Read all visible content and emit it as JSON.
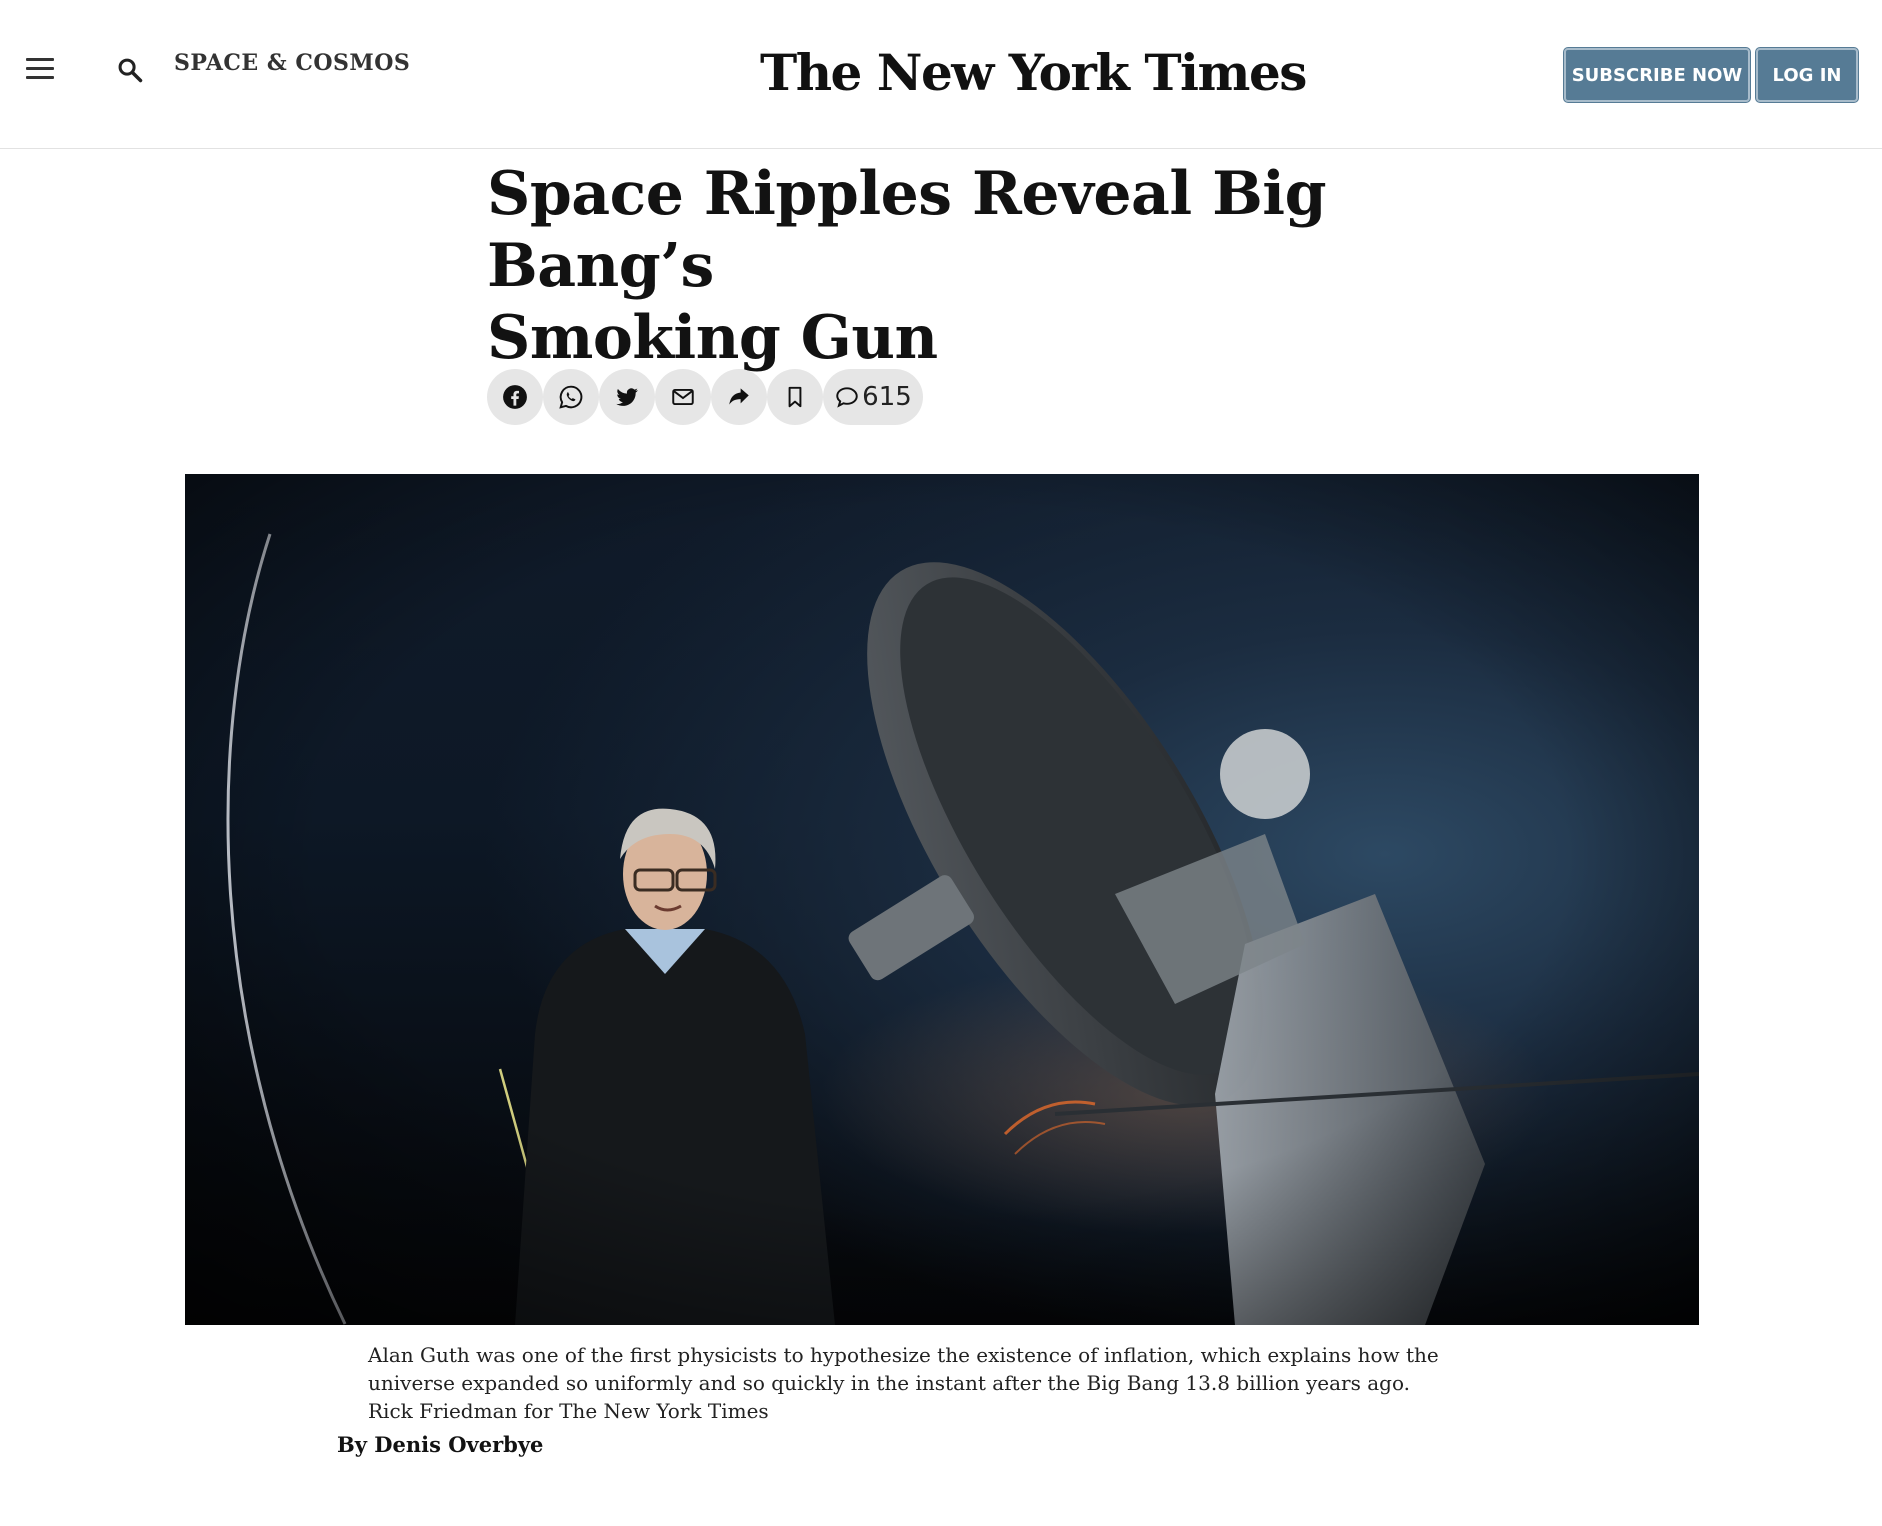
{
  "header": {
    "section": "SPACE & COSMOS",
    "logo_text": "The New York Times",
    "subscribe_label": "SUBSCRIBE NOW",
    "login_label": "LOG IN"
  },
  "article": {
    "headline_line1": "Space Ripples Reveal Big Bang’s",
    "headline_line2": "Smoking Gun",
    "comment_count": "615",
    "share_icons": [
      "facebook-icon",
      "whatsapp-icon",
      "twitter-icon",
      "email-icon",
      "share-icon",
      "bookmark-icon",
      "comment-icon"
    ],
    "caption_text": "Alan Guth was one of the first physicists to hypothesize the existence of inflation, which explains how the universe expanded so uniformly and so quickly in the instant after the Big Bang 13.8 billion years ago.",
    "caption_credit": "Rick Friedman for The New York Times",
    "byline": "By Denis Overbye"
  },
  "colors": {
    "button_bg": "#567b95",
    "share_bg": "#e6e6e6"
  }
}
